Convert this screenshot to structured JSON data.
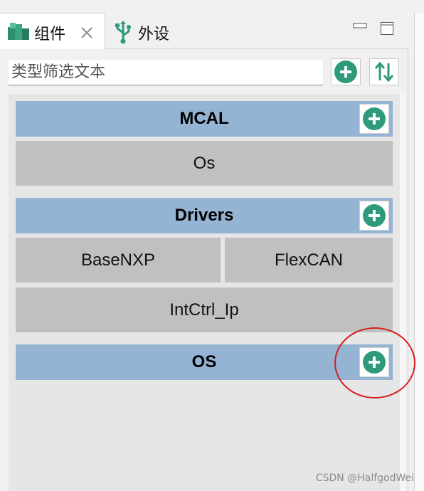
{
  "tabs": [
    {
      "label": "组件",
      "icon": "components-icon",
      "active": true
    },
    {
      "label": "外设",
      "icon": "usb-icon",
      "active": false
    }
  ],
  "filter": {
    "placeholder": "类型筛选文本"
  },
  "groups": [
    {
      "title": "MCAL",
      "items": [
        "Os"
      ]
    },
    {
      "title": "Drivers",
      "items": [
        "BaseNXP",
        "FlexCAN",
        "IntCtrl_Ip"
      ]
    },
    {
      "title": "OS",
      "items": []
    }
  ],
  "watermark": "CSDN @HalfgodWei",
  "colors": {
    "accent": "#2e9a7c",
    "header": "#95b3d3",
    "item": "#c0c0c0",
    "annotation": "#d81e1e"
  }
}
